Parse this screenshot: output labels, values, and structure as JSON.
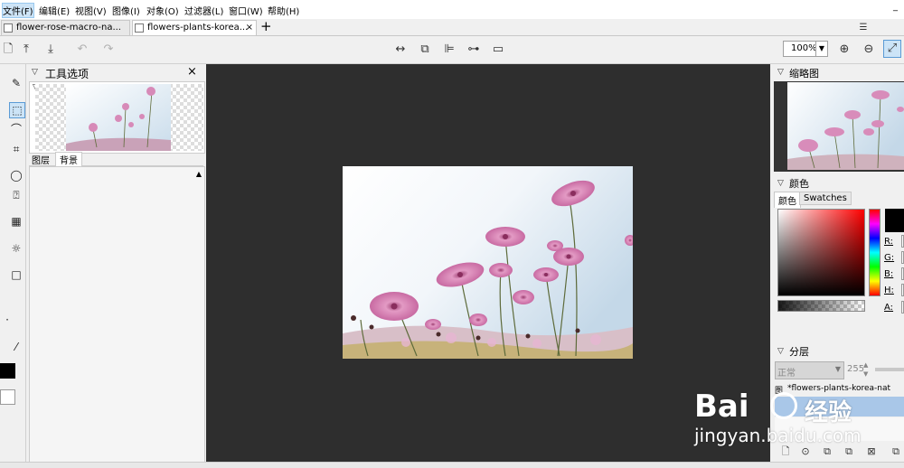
{
  "menu": {
    "items": [
      "文件(F)",
      "编辑(E)",
      "视图(V)",
      "图像(I)",
      "对象(O)",
      "过滤器(L)",
      "窗口(W)",
      "帮助(H)"
    ],
    "minimize": "_"
  },
  "tabs": [
    {
      "label": "flower-rose-macro-na...",
      "close": "×"
    },
    {
      "label": "flowers-plants-korea...",
      "close": "×"
    }
  ],
  "new_tab_symbol": "+",
  "toolbar": {
    "zoom_value": "100%",
    "icons": [
      "open-file-icon",
      "upload-icon",
      "download-icon",
      "undo-icon",
      "redo-icon",
      "fit-width-icon",
      "crop-icon",
      "align-left-icon",
      "distribute-icon",
      "resize-canvas-icon",
      "zoom-in-icon",
      "zoom-out-icon",
      "fit-window-icon"
    ]
  },
  "tool_options": {
    "title": "工具选项",
    "close": "×",
    "layer_tabs": [
      "图层",
      "背景"
    ]
  },
  "thumbnail_panel": {
    "title": "缩略图"
  },
  "color_panel": {
    "title": "颜色",
    "tabs": [
      "颜色",
      "Swatches"
    ],
    "channels": [
      "R:",
      "G:",
      "B:",
      "H:",
      "A:"
    ],
    "current_color": "#000000"
  },
  "layers_panel": {
    "title": "分层",
    "blend_mode": "正常",
    "opacity": "255",
    "layer_name": "*flowers-plants-korea-nat",
    "layer_prefix": "图"
  },
  "watermark": {
    "brand": "Bai",
    "brand_cn": "经验",
    "url": "jingyan.baidu.com"
  },
  "colors": {
    "canvas_bg": "#2e2e2e",
    "panel_bg": "#f0f0f0",
    "selected_layer": "#a9c7e8"
  }
}
